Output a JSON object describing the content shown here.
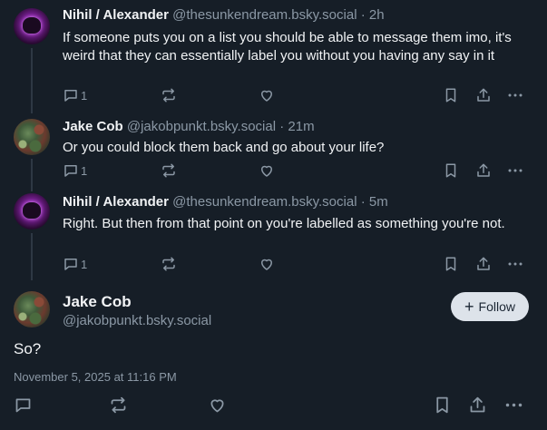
{
  "posts": [
    {
      "name": "Nihil / Alexander",
      "handle": "@thesunkendream.bsky.social",
      "time": "· 2h",
      "text": "If someone puts you on a list you should be able to message them imo, it's weird that they can essentially label you without you having any say in it",
      "reply_count": "1"
    },
    {
      "name": "Jake Cob",
      "handle": "@jakobpunkt.bsky.social",
      "time": "· 21m",
      "text": "Or you could block them back and go about your life?",
      "reply_count": "1"
    },
    {
      "name": "Nihil / Alexander",
      "handle": "@thesunkendream.bsky.social",
      "time": "· 5m",
      "text": "Right. But then from that point on you're labelled as something you're not.",
      "reply_count": "1"
    }
  ],
  "main_post": {
    "name": "Jake Cob",
    "handle": "@jakobpunkt.bsky.social",
    "follow_label": "Follow",
    "text": "So?",
    "timestamp": "November 5, 2025 at 11:16 PM"
  },
  "icons": [
    "reply-icon",
    "repost-icon",
    "like-icon",
    "bookmark-icon",
    "share-icon",
    "more-icon",
    "plus-icon"
  ],
  "colors": {
    "background": "#161e27",
    "muted": "#8b98a5",
    "follow_bg": "#dde3ea"
  }
}
